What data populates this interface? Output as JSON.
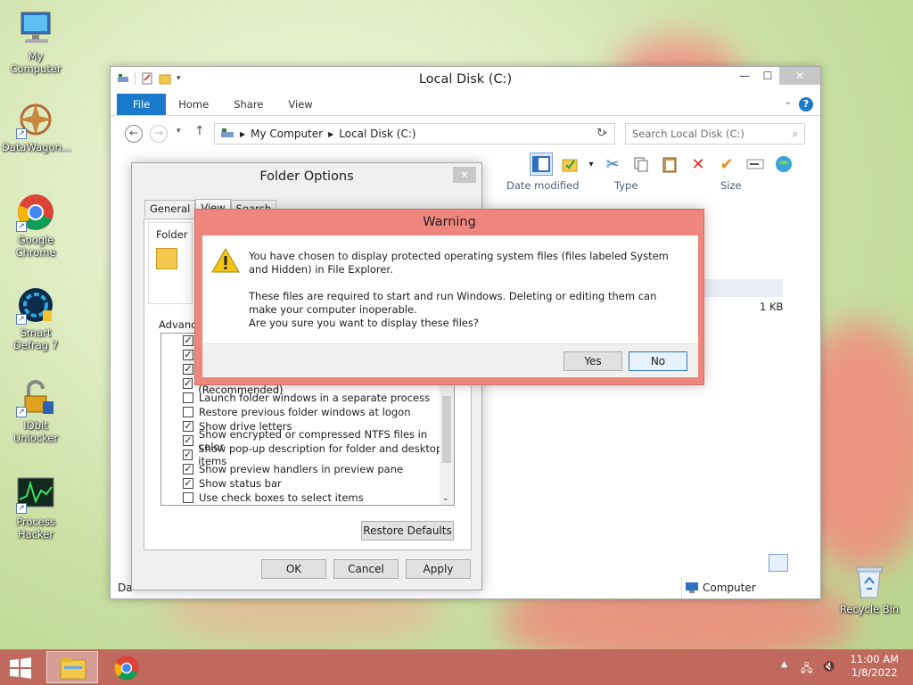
{
  "desktop": {
    "icons": [
      {
        "label": "My Computer"
      },
      {
        "label": "DataWagon..."
      },
      {
        "label": "Google Chrome"
      },
      {
        "label": "Smart Defrag 7"
      },
      {
        "label": "IObit Unlocker"
      },
      {
        "label": "Process Hacker"
      },
      {
        "label": "Recycle Bin"
      }
    ]
  },
  "explorer": {
    "title": "Local Disk (C:)",
    "tabs": [
      "File",
      "Home",
      "Share",
      "View"
    ],
    "breadcrumb": [
      "My Computer",
      "Local Disk (C:)"
    ],
    "search_placeholder": "Search Local Disk (C:)",
    "columns": [
      "Date modified",
      "Type",
      "Size"
    ],
    "file_size": "1 KB",
    "status_left": "Da",
    "status_location": "Computer"
  },
  "folder_options": {
    "title": "Folder Options",
    "tabs": [
      "General",
      "View",
      "Search"
    ],
    "group_label": "Folder",
    "advanced_label": "Advance",
    "items": [
      {
        "label": "",
        "checked": true
      },
      {
        "label": "",
        "checked": true
      },
      {
        "label": "",
        "checked": true
      },
      {
        "label": "Hide protected operating system files (Recommended)",
        "checked": true
      },
      {
        "label": "Launch folder windows in a separate process",
        "checked": false
      },
      {
        "label": "Restore previous folder windows at logon",
        "checked": false
      },
      {
        "label": "Show drive letters",
        "checked": true
      },
      {
        "label": "Show encrypted or compressed NTFS files in color",
        "checked": true
      },
      {
        "label": "Show pop-up description for folder and desktop items",
        "checked": true
      },
      {
        "label": "Show preview handlers in preview pane",
        "checked": true
      },
      {
        "label": "Show status bar",
        "checked": true
      },
      {
        "label": "Use check boxes to select items",
        "checked": false
      }
    ],
    "restore_defaults": "Restore Defaults",
    "ok": "OK",
    "cancel": "Cancel",
    "apply": "Apply"
  },
  "warning": {
    "title": "Warning",
    "line1": "You have chosen to display protected operating system files (files labeled System and Hidden) in File Explorer.",
    "line2": "These files are required to start and run Windows. Deleting or editing them can make your computer inoperable.",
    "line3": "Are you sure you want to display these files?",
    "yes": "Yes",
    "no": "No"
  },
  "taskbar": {
    "time": "11:00 AM",
    "date": "1/8/2022"
  }
}
